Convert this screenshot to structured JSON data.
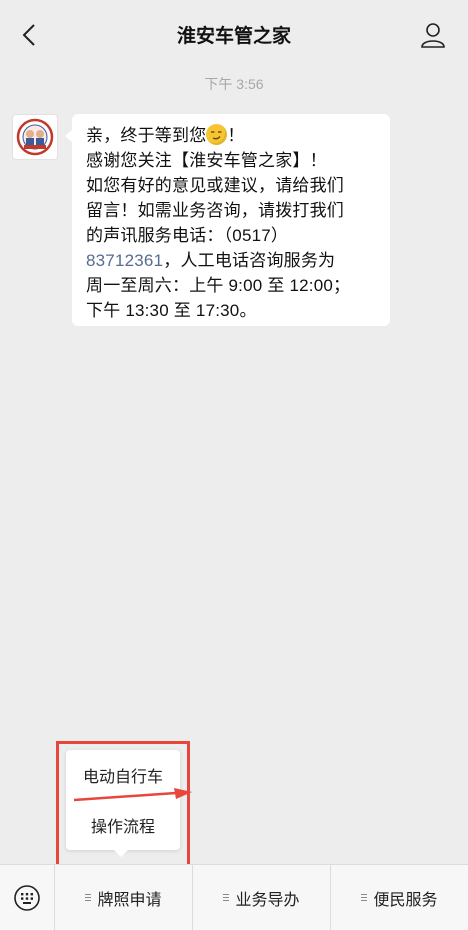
{
  "header": {
    "title": "淮安车管之家"
  },
  "timestamp": "下午 3:56",
  "message": {
    "line1": "亲，终于等到您",
    "line1_tail": "！",
    "line2": "感谢您关注【淮安车管之家】！",
    "line3": "如您有好的意见或建议，请给我们",
    "line4": "留言！如需业务咨询，请拨打我们",
    "line5": "的声讯服务电话：（0517）",
    "phone": "83712361",
    "line6_tail": "，人工电话咨询服务为",
    "line7": "周一至周六：上午 9:00 至 12:00；",
    "line8": "下午 13:30 至 17:30。"
  },
  "popup": {
    "items": [
      "电动自行车",
      "操作流程"
    ]
  },
  "menu": {
    "items": [
      "牌照申请",
      "业务导办",
      "便民服务"
    ]
  },
  "colors": {
    "background": "#ededed",
    "link": "#576b95",
    "annotation": "#e8453c"
  },
  "icons": {
    "back": "chevron-left-icon",
    "profile": "person-icon",
    "keyboard": "keyboard-icon",
    "emoji": "smirk-emoji-icon"
  }
}
